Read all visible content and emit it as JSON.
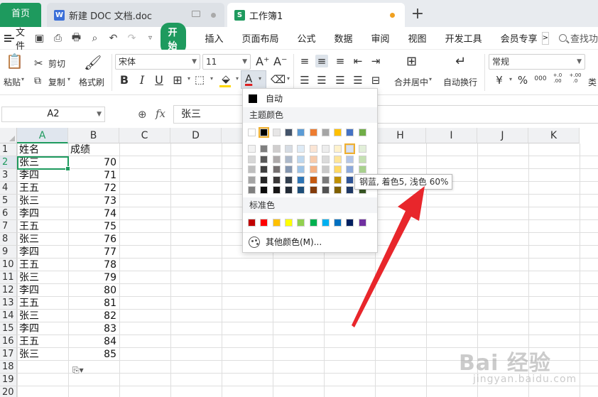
{
  "tabs": {
    "home": "首页",
    "doc": "新建 DOC 文档.doc",
    "doc_icon": "W",
    "book": "工作簿1",
    "book_icon": "S",
    "add": "+"
  },
  "menu": {
    "file": "文件",
    "start": "开始",
    "items": [
      "插入",
      "页面布局",
      "公式",
      "数据",
      "审阅",
      "视图",
      "开发工具",
      "会员专享"
    ],
    "more": ">",
    "search": "查找功"
  },
  "ribbon": {
    "paste": "粘贴",
    "cut": "剪切",
    "copy": "复制",
    "format_painter": "格式刷",
    "font_name": "宋体",
    "font_size": "11",
    "bold": "B",
    "italic": "I",
    "underline": "U",
    "font_color_letter": "A",
    "merge_center": "合并居中",
    "wrap_text": "自动换行",
    "number_format": "常规",
    "currency": "¥",
    "percent": "%",
    "thousands": "000",
    "inc_decimal": "+.0 .00",
    "dec_decimal": "+.00 .0",
    "more_type": "类"
  },
  "formula_bar": {
    "name_box": "A2",
    "fx": "fx",
    "content": "张三"
  },
  "grid": {
    "columns": [
      "A",
      "B",
      "C",
      "D",
      "E",
      "F",
      "G",
      "H",
      "I",
      "J",
      "K"
    ],
    "selected_column": "A",
    "rows": [
      "1",
      "2",
      "3",
      "4",
      "5",
      "6",
      "7",
      "8",
      "9",
      "10",
      "11",
      "12",
      "13",
      "14",
      "15",
      "16",
      "17",
      "18",
      "19",
      "20"
    ],
    "selected_row": "2",
    "header": [
      "姓名",
      "成绩"
    ],
    "data": [
      [
        "张三",
        "70"
      ],
      [
        "李四",
        "71"
      ],
      [
        "王五",
        "72"
      ],
      [
        "张三",
        "73"
      ],
      [
        "李四",
        "74"
      ],
      [
        "王五",
        "75"
      ],
      [
        "张三",
        "76"
      ],
      [
        "李四",
        "77"
      ],
      [
        "王五",
        "78"
      ],
      [
        "张三",
        "79"
      ],
      [
        "李四",
        "80"
      ],
      [
        "王五",
        "81"
      ],
      [
        "张三",
        "82"
      ],
      [
        "李四",
        "83"
      ],
      [
        "王五",
        "84"
      ],
      [
        "张三",
        "85"
      ]
    ]
  },
  "color_dropdown": {
    "auto": "自动",
    "theme_title": "主题颜色",
    "standard_title": "标准色",
    "more_colors": "其他颜色(M)...",
    "theme_top": [
      "#ffffff",
      "#000000",
      "#e7e6e6",
      "#44546a",
      "#5b9bd5",
      "#ed7d31",
      "#a5a5a5",
      "#ffc000",
      "#4472c4",
      "#70ad47"
    ],
    "theme_shades": [
      [
        "#f2f2f2",
        "#7f7f7f",
        "#d0cece",
        "#d6dce4",
        "#deebf6",
        "#fbe5d5",
        "#ededed",
        "#fff2cc",
        "#dae3f3",
        "#e2efd9"
      ],
      [
        "#d8d8d8",
        "#595959",
        "#aeaaaa",
        "#adb9ca",
        "#bdd7ee",
        "#f7cbac",
        "#dbdbdb",
        "#fee599",
        "#b4c6e7",
        "#c5e0b3"
      ],
      [
        "#bfbfbf",
        "#3f3f3f",
        "#757070",
        "#8496b0",
        "#9dc3e6",
        "#f4b183",
        "#c9c9c9",
        "#ffd965",
        "#8eaadb",
        "#a8d08d"
      ],
      [
        "#a5a5a5",
        "#262626",
        "#3a3838",
        "#323f4f",
        "#2e75b5",
        "#c55a11",
        "#7b7b7b",
        "#bf9000",
        "#2f5496",
        "#538135"
      ],
      [
        "#7f7f7f",
        "#0c0c0c",
        "#171616",
        "#222a35",
        "#1e4e79",
        "#833c0b",
        "#525252",
        "#7f6000",
        "#1f3864",
        "#375623"
      ]
    ],
    "standard": [
      "#c00000",
      "#ff0000",
      "#ffc000",
      "#ffff00",
      "#92d050",
      "#00b050",
      "#00b0f0",
      "#0070c0",
      "#002060",
      "#7030a0"
    ],
    "hover_index": [
      0,
      8
    ]
  },
  "tooltip": "钢蓝, 着色5, 浅色 60%",
  "colors": {
    "accent": "#1e9a5e",
    "arrow": "#e8262b"
  },
  "watermark": {
    "main": "Bai 经验",
    "sub": "jingyan.baidu.com"
  }
}
